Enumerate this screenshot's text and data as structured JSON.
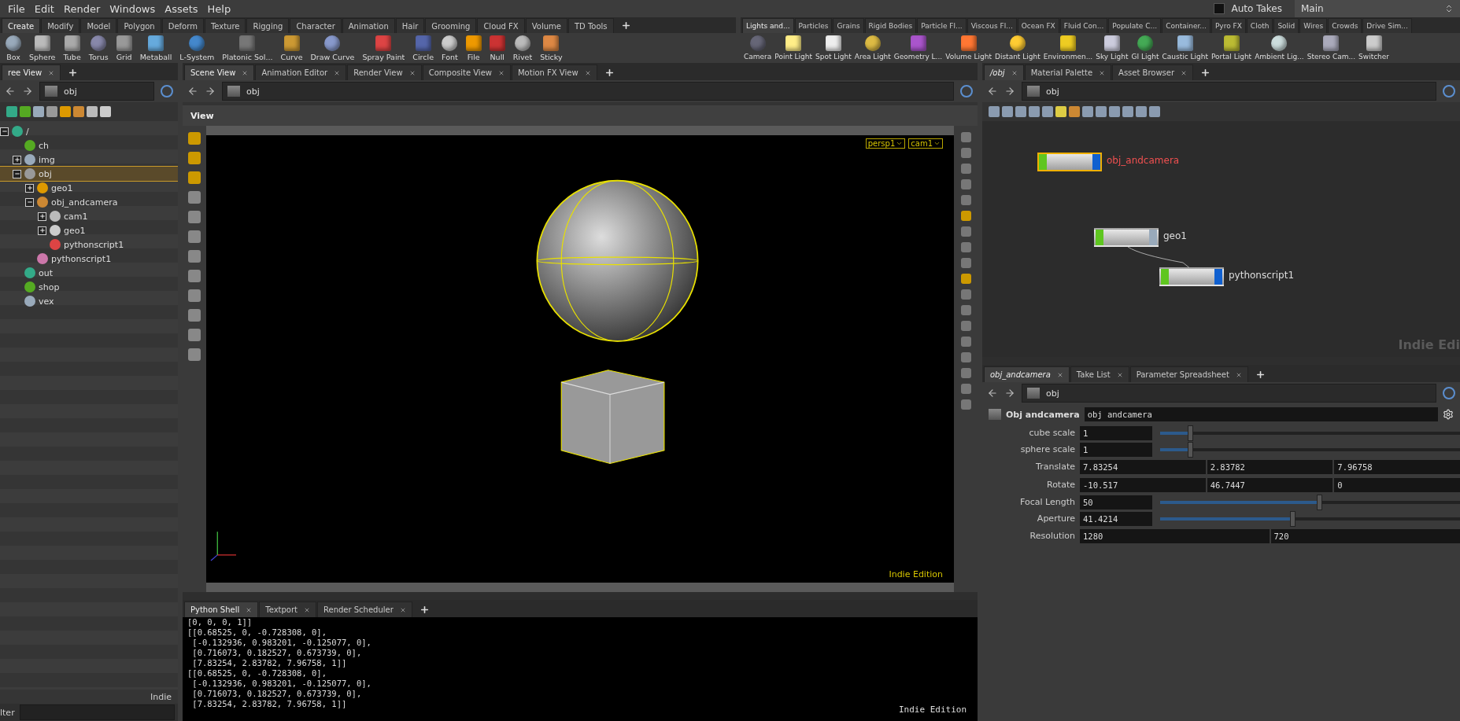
{
  "menu": [
    "File",
    "Edit",
    "Render",
    "Windows",
    "Assets",
    "Help"
  ],
  "auto_takes": {
    "label": "Auto Takes",
    "checked": false
  },
  "desktop": {
    "value": "Main"
  },
  "shelf_left": {
    "tabs": [
      {
        "label": "Create",
        "selected": true
      },
      {
        "label": "Modify",
        "selected": false
      },
      {
        "label": "Model",
        "selected": false
      },
      {
        "label": "Polygon",
        "selected": false
      },
      {
        "label": "Deform",
        "selected": false
      },
      {
        "label": "Texture",
        "selected": false
      },
      {
        "label": "Rigging",
        "selected": false
      },
      {
        "label": "Character",
        "selected": false
      },
      {
        "label": "Animation",
        "selected": false
      },
      {
        "label": "Hair",
        "selected": false
      },
      {
        "label": "Grooming",
        "selected": false
      },
      {
        "label": "Cloud FX",
        "selected": false
      },
      {
        "label": "Volume",
        "selected": false
      },
      {
        "label": "TD Tools",
        "selected": false
      }
    ],
    "tools": [
      "Box",
      "Sphere",
      "Tube",
      "Torus",
      "Grid",
      "Metaball",
      "L-System",
      "Platonic Sol...",
      "Curve",
      "Draw Curve",
      "Spray Paint",
      "Circle",
      "Font",
      "File",
      "Null",
      "Rivet",
      "Sticky"
    ]
  },
  "shelf_right": {
    "tabs": [
      {
        "label": "Lights and...",
        "selected": true
      },
      {
        "label": "Particles",
        "selected": false
      },
      {
        "label": "Grains",
        "selected": false
      },
      {
        "label": "Rigid Bodies",
        "selected": false
      },
      {
        "label": "Particle Fl...",
        "selected": false
      },
      {
        "label": "Viscous Fl...",
        "selected": false
      },
      {
        "label": "Ocean FX",
        "selected": false
      },
      {
        "label": "Fluid Con...",
        "selected": false
      },
      {
        "label": "Populate C...",
        "selected": false
      },
      {
        "label": "Container...",
        "selected": false
      },
      {
        "label": "Pyro FX",
        "selected": false
      },
      {
        "label": "Cloth",
        "selected": false
      },
      {
        "label": "Solid",
        "selected": false
      },
      {
        "label": "Wires",
        "selected": false
      },
      {
        "label": "Crowds",
        "selected": false
      },
      {
        "label": "Drive Sim...",
        "selected": false
      }
    ],
    "tools": [
      "Camera",
      "Point Light",
      "Spot Light",
      "Area Light",
      "Geometry L...",
      "Volume Light",
      "Distant Light",
      "Environmen...",
      "Sky Light",
      "GI Light",
      "Caustic Light",
      "Portal Light",
      "Ambient Lig...",
      "Stereo Cam...",
      "Switcher"
    ]
  },
  "tree_pane": {
    "tabs": [
      {
        "label": "ree View",
        "selected": true
      }
    ],
    "path": "obj",
    "tree": [
      {
        "label": "/",
        "expanded": true,
        "selected": false,
        "children": [
          {
            "label": "ch",
            "selected": false
          },
          {
            "label": "img",
            "expanded": false,
            "selected": false
          },
          {
            "label": "obj",
            "expanded": true,
            "selected": true,
            "children": [
              {
                "label": "geo1",
                "expanded": false,
                "selected": false
              },
              {
                "label": "obj_andcamera",
                "expanded": true,
                "selected": false,
                "children": [
                  {
                    "label": "cam1",
                    "expanded": false,
                    "selected": false
                  },
                  {
                    "label": "geo1",
                    "expanded": false,
                    "selected": false
                  },
                  {
                    "label": "pythonscript1",
                    "selected": false
                  }
                ]
              },
              {
                "label": "pythonscript1",
                "selected": false
              }
            ]
          },
          {
            "label": "out",
            "selected": false
          },
          {
            "label": "shop",
            "selected": false
          },
          {
            "label": "vex",
            "selected": false
          }
        ]
      }
    ],
    "footer": "Indie",
    "filter_label": "lter"
  },
  "scene_pane": {
    "tabs": [
      {
        "label": "Scene View",
        "selected": true
      },
      {
        "label": "Animation Editor",
        "selected": false
      },
      {
        "label": "Render View",
        "selected": false
      },
      {
        "label": "Composite View",
        "selected": false
      },
      {
        "label": "Motion FX View",
        "selected": false
      }
    ],
    "path": "obj",
    "header": "View",
    "camera_menus": [
      "persp1",
      "cam1"
    ],
    "edition": "Indie Edition"
  },
  "shell_pane": {
    "tabs": [
      {
        "label": "Python Shell",
        "selected": true
      },
      {
        "label": "Textport",
        "selected": false
      },
      {
        "label": "Render Scheduler",
        "selected": false
      }
    ],
    "lines": [
      "[0, 0, 0, 1]]",
      "[[0.68525, 0, -0.728308, 0],",
      " [-0.132936, 0.983201, -0.125077, 0],",
      " [0.716073, 0.182527, 0.673739, 0],",
      " [7.83254, 2.83782, 7.96758, 1]]",
      "[[0.68525, 0, -0.728308, 0],",
      " [-0.132936, 0.983201, -0.125077, 0],",
      " [0.716073, 0.182527, 0.673739, 0],",
      " [7.83254, 2.83782, 7.96758, 1]]"
    ],
    "edition": "Indie Edition"
  },
  "network_pane": {
    "tabs": [
      {
        "label": "/obj",
        "selected": true
      },
      {
        "label": "Material Palette",
        "selected": false
      },
      {
        "label": "Asset Browser",
        "selected": false
      }
    ],
    "path": "obj",
    "nodes": [
      {
        "name": "obj_andcamera",
        "selected": true
      },
      {
        "name": "geo1",
        "selected": false
      },
      {
        "name": "pythonscript1",
        "selected": false
      }
    ],
    "watermark": "Indie Edi"
  },
  "params_pane": {
    "tabs": [
      {
        "label": "obj_andcamera",
        "selected": true
      },
      {
        "label": "Take List",
        "selected": false
      },
      {
        "label": "Parameter Spreadsheet",
        "selected": false
      }
    ],
    "path": "obj",
    "node_type": "Obj andcamera",
    "node_name": "obj_andcamera",
    "rows": [
      {
        "kind": "slider",
        "label": "cube scale",
        "value": "1",
        "level": 0.1
      },
      {
        "kind": "slider",
        "label": "sphere scale",
        "value": "1",
        "level": 0.1
      },
      {
        "kind": "vector",
        "label": "Translate",
        "values": [
          "7.83254",
          "2.83782",
          "7.96758"
        ]
      },
      {
        "kind": "vector",
        "label": "Rotate",
        "values": [
          "-10.517",
          "46.7447",
          "0"
        ]
      },
      {
        "kind": "slider",
        "label": "Focal Length",
        "value": "50",
        "level": 0.53
      },
      {
        "kind": "slider",
        "label": "Aperture",
        "value": "41.4214",
        "level": 0.44
      },
      {
        "kind": "vector",
        "label": "Resolution",
        "values": [
          "1280",
          "720"
        ]
      }
    ]
  }
}
